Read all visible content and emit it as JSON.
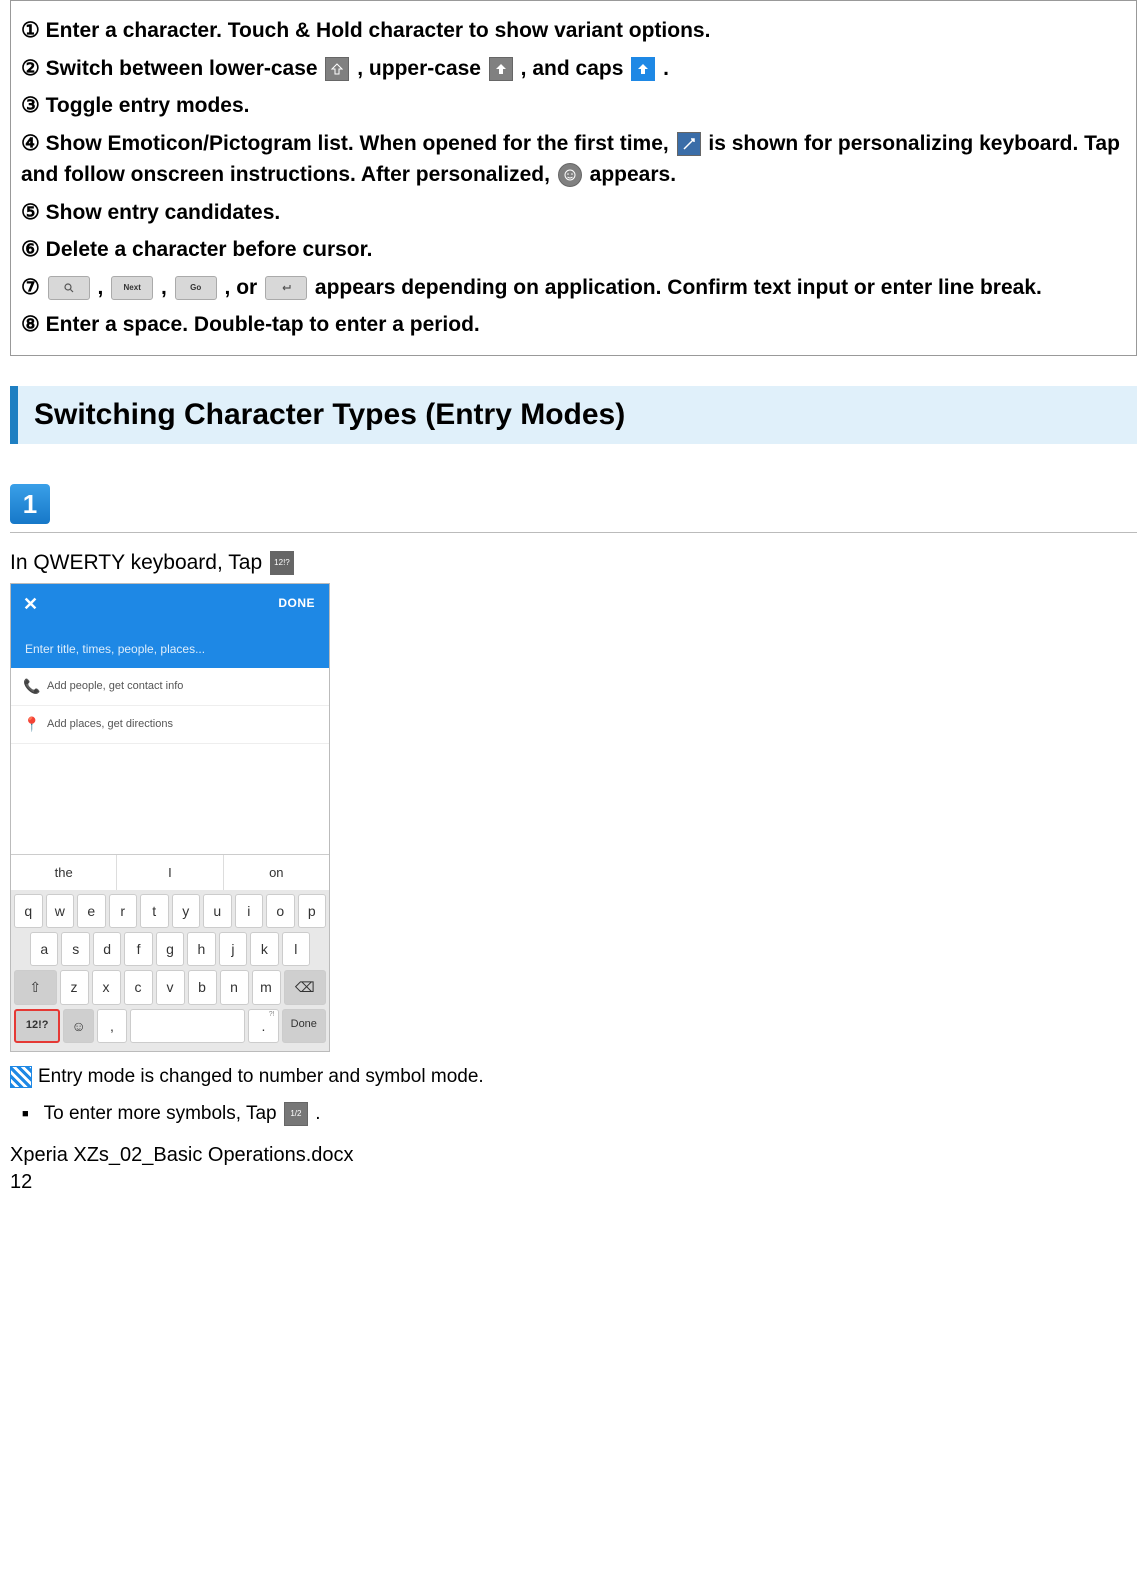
{
  "box": {
    "i1": "① Enter a character. Touch & Hold character to show variant options.",
    "i2a": "② Switch between lower-case ",
    "i2b": ", upper-case ",
    "i2c": ", and caps ",
    "i2d": ".",
    "i3": "③ Toggle entry modes.",
    "i4a": "④ Show Emoticon/Pictogram list. When opened for the first time, ",
    "i4b": " is shown for personalizing keyboard. Tap and follow onscreen instructions. After personalized, ",
    "i4c": " appears.",
    "i5": "⑤ Show entry candidates.",
    "i6": "⑥ Delete a character before cursor.",
    "i7a": "⑦ ",
    "i7b": ", ",
    "i7c": ", ",
    "i7d": ", or ",
    "i7e": " appears depending on application. Confirm text input or enter line break.",
    "i8": "⑧ Enter a space. Double-tap to enter a period.",
    "key_next": "Next",
    "key_go": "Go"
  },
  "section_title": "Switching Character Types (Entry Modes)",
  "step_number": "1",
  "instr1a": "In QWERTY keyboard, Tap ",
  "instr1_icon_label": "12!?",
  "screenshot": {
    "done": "DONE",
    "placeholder": "Enter title, times, people, places...",
    "row1": "Add people, get contact info",
    "row2": "Add places, get directions",
    "sugg": [
      "the",
      "I",
      "on"
    ],
    "kb_r1": [
      "q",
      "w",
      "e",
      "r",
      "t",
      "y",
      "u",
      "i",
      "o",
      "p"
    ],
    "kb_r2": [
      "a",
      "s",
      "d",
      "f",
      "g",
      "h",
      "j",
      "k",
      "l"
    ],
    "kb_r3_shift": "⇧",
    "kb_r3": [
      "z",
      "x",
      "c",
      "v",
      "b",
      "n",
      "m"
    ],
    "kb_r3_del": "⌫",
    "kb_r4_mode": "12!?",
    "kb_r4_emoji": "☺",
    "kb_r4_comma": ",",
    "kb_r4_space": "",
    "kb_r4_period": ".",
    "kb_r4_period_sup": "?!",
    "kb_r4_done": "Done"
  },
  "note": "Entry mode is changed to number and symbol mode.",
  "bullet_a": "To enter more symbols, Tap ",
  "bullet_b": ".",
  "bullet_icon_label": "1/2",
  "footer_file": "Xperia XZs_02_Basic Operations.docx",
  "footer_page": "12"
}
